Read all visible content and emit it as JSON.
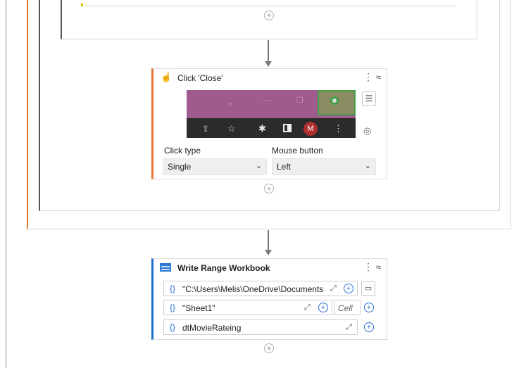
{
  "click_activity": {
    "title": "Click 'Close'",
    "click_type_label": "Click type",
    "click_type_value": "Single",
    "mouse_button_label": "Mouse button",
    "mouse_button_value": "Left",
    "browser_avatar_letter": "M"
  },
  "write_range_activity": {
    "title": "Write Range Workbook",
    "path_value": "\"C:\\Users\\Melis\\OneDrive\\Documents'",
    "sheet_value": "\"Sheet1\"",
    "cell_placeholder": "Cell",
    "datatable_value": "dtMovieRateing"
  },
  "icons": {
    "kebab": "⋮",
    "collapse": "⌃",
    "plus": "+",
    "brace": "{}",
    "chevron": "⌄",
    "expand": "⤢"
  },
  "colors": {
    "accent_orange": "#e8743b",
    "accent_blue": "#1f6fce",
    "browser_pink": "#a05a8c",
    "browser_dark": "#2b2b2b",
    "highlight_green": "#3fa14b"
  }
}
